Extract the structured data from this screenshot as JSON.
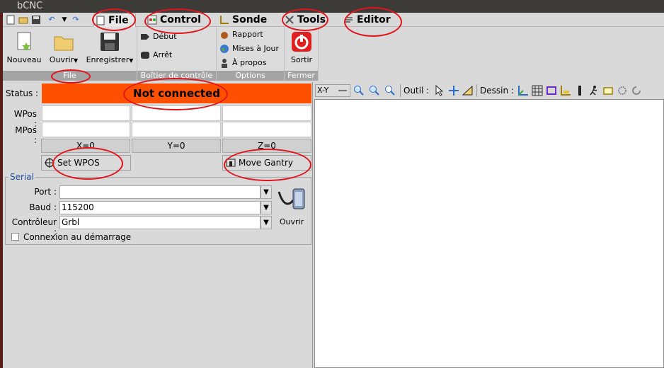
{
  "window": {
    "title": "bCNC"
  },
  "menu": {
    "quick": [
      "new-file-icon",
      "open-folder-icon",
      "save-icon",
      "undo-icon",
      "dropdown-icon",
      "redo-icon"
    ],
    "tabs": [
      {
        "label": "File",
        "icon": "document-icon"
      },
      {
        "label": "Control",
        "icon": "control-icon"
      },
      {
        "label": "Sonde",
        "icon": "probe-icon"
      },
      {
        "label": "Tools",
        "icon": "tools-icon"
      },
      {
        "label": "Editor",
        "icon": "editor-icon"
      }
    ]
  },
  "ribbon": {
    "file": {
      "label": "File",
      "new": "Nouveau",
      "open": "Ouvrir",
      "save": "Enregistrer"
    },
    "control": {
      "label": "Boîtier de contrôle",
      "start": "Début",
      "stop": "Arrêt"
    },
    "options": {
      "label": "Options",
      "report": "Rapport",
      "updates": "Mises à Jour",
      "about": "À propos"
    },
    "close": {
      "label": "Fermer",
      "exit": "Sortir"
    }
  },
  "status": {
    "label": "Status :",
    "value": "Not connected",
    "color": "#ff5000"
  },
  "positions": {
    "wpos_label": "WPos :",
    "mpos_label": "MPos :",
    "zero_x": "X=0",
    "zero_y": "Y=0",
    "zero_z": "Z=0",
    "set_wpos": "Set WPOS",
    "move_gantry": "Move Gantry"
  },
  "serial": {
    "title": "Serial",
    "port_label": "Port :",
    "port_value": "",
    "baud_label": "Baud :",
    "baud_value": "115200",
    "controller_label": "Contrôleur :",
    "controller_value": "Grbl",
    "open_label": "Ouvrir",
    "autoconnect_label": "Connexion au démarrage",
    "autoconnect_checked": false
  },
  "canvas_toolbar": {
    "view": "X-Y",
    "tool_label": "Outil :",
    "draw_label": "Dessin :"
  },
  "colors": {
    "annotation": "#e0141a",
    "accent": "#1d4fa1"
  }
}
